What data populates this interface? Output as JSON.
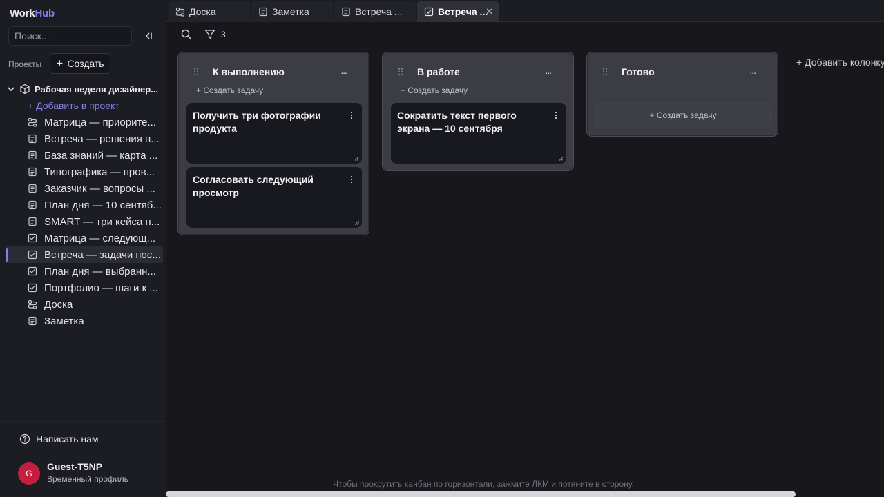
{
  "app": {
    "logo_work": "Work",
    "logo_hub": "Hub"
  },
  "sidebar": {
    "search_placeholder": "Поиск...",
    "projects_label": "Проекты",
    "create_label": "Создать",
    "project_name": "Рабочая неделя дизайнер...",
    "add_to_project": "+ Добавить в проект",
    "items": [
      {
        "label": "Матрица — приорите...",
        "icon": "board-icon"
      },
      {
        "label": "Встреча — решения п...",
        "icon": "note-icon"
      },
      {
        "label": "База знаний — карта ...",
        "icon": "note-icon"
      },
      {
        "label": "Типографика — пров...",
        "icon": "note-icon"
      },
      {
        "label": "Заказчик — вопросы ...",
        "icon": "note-icon"
      },
      {
        "label": "План дня — 10 сентяб...",
        "icon": "note-icon"
      },
      {
        "label": "SMART — три кейса п...",
        "icon": "note-icon"
      },
      {
        "label": "Матрица — следующ...",
        "icon": "checklist-icon"
      },
      {
        "label": "Встреча — задачи пос...",
        "icon": "checklist-icon"
      },
      {
        "label": "План дня — выбранн...",
        "icon": "checklist-icon"
      },
      {
        "label": "Портфолио — шаги к ...",
        "icon": "checklist-icon"
      },
      {
        "label": "Доска",
        "icon": "board-icon"
      },
      {
        "label": "Заметка",
        "icon": "note-icon"
      }
    ],
    "contact_label": "Написать нам",
    "user": {
      "initial": "G",
      "name": "Guest-T5NP",
      "type": "Временный профиль"
    }
  },
  "tabs": [
    {
      "label": "Доска",
      "icon": "board-icon"
    },
    {
      "label": "Заметка",
      "icon": "note-icon"
    },
    {
      "label": "Встреча ...",
      "icon": "note-icon"
    },
    {
      "label": "Встреча ...",
      "icon": "checklist-icon",
      "close": "✕"
    }
  ],
  "toolbar": {
    "filter_count": "3"
  },
  "board": {
    "create_task": "+ Создать задачу",
    "add_column": "+ Добавить колонку",
    "columns": [
      {
        "title": "К выполнению",
        "more": "...",
        "cards": [
          {
            "text": "Получить три фотографии продукта"
          },
          {
            "text": "Согласовать следующий просмотр"
          }
        ]
      },
      {
        "title": "В работе",
        "more": "...",
        "cards": [
          {
            "text": "Сократить текст первого экрана — 10 сентября"
          }
        ]
      },
      {
        "title": "Готово",
        "more": "...",
        "cards": []
      }
    ],
    "hint": "Чтобы прокрутить канбан по горизонтали, зажмите ЛКМ и потяните в сторону."
  },
  "colors": {
    "accent": "#8a7be8",
    "avatar": "#c3203f",
    "background": "#17171c",
    "column": "#3b3c44",
    "card": "#18191f"
  }
}
